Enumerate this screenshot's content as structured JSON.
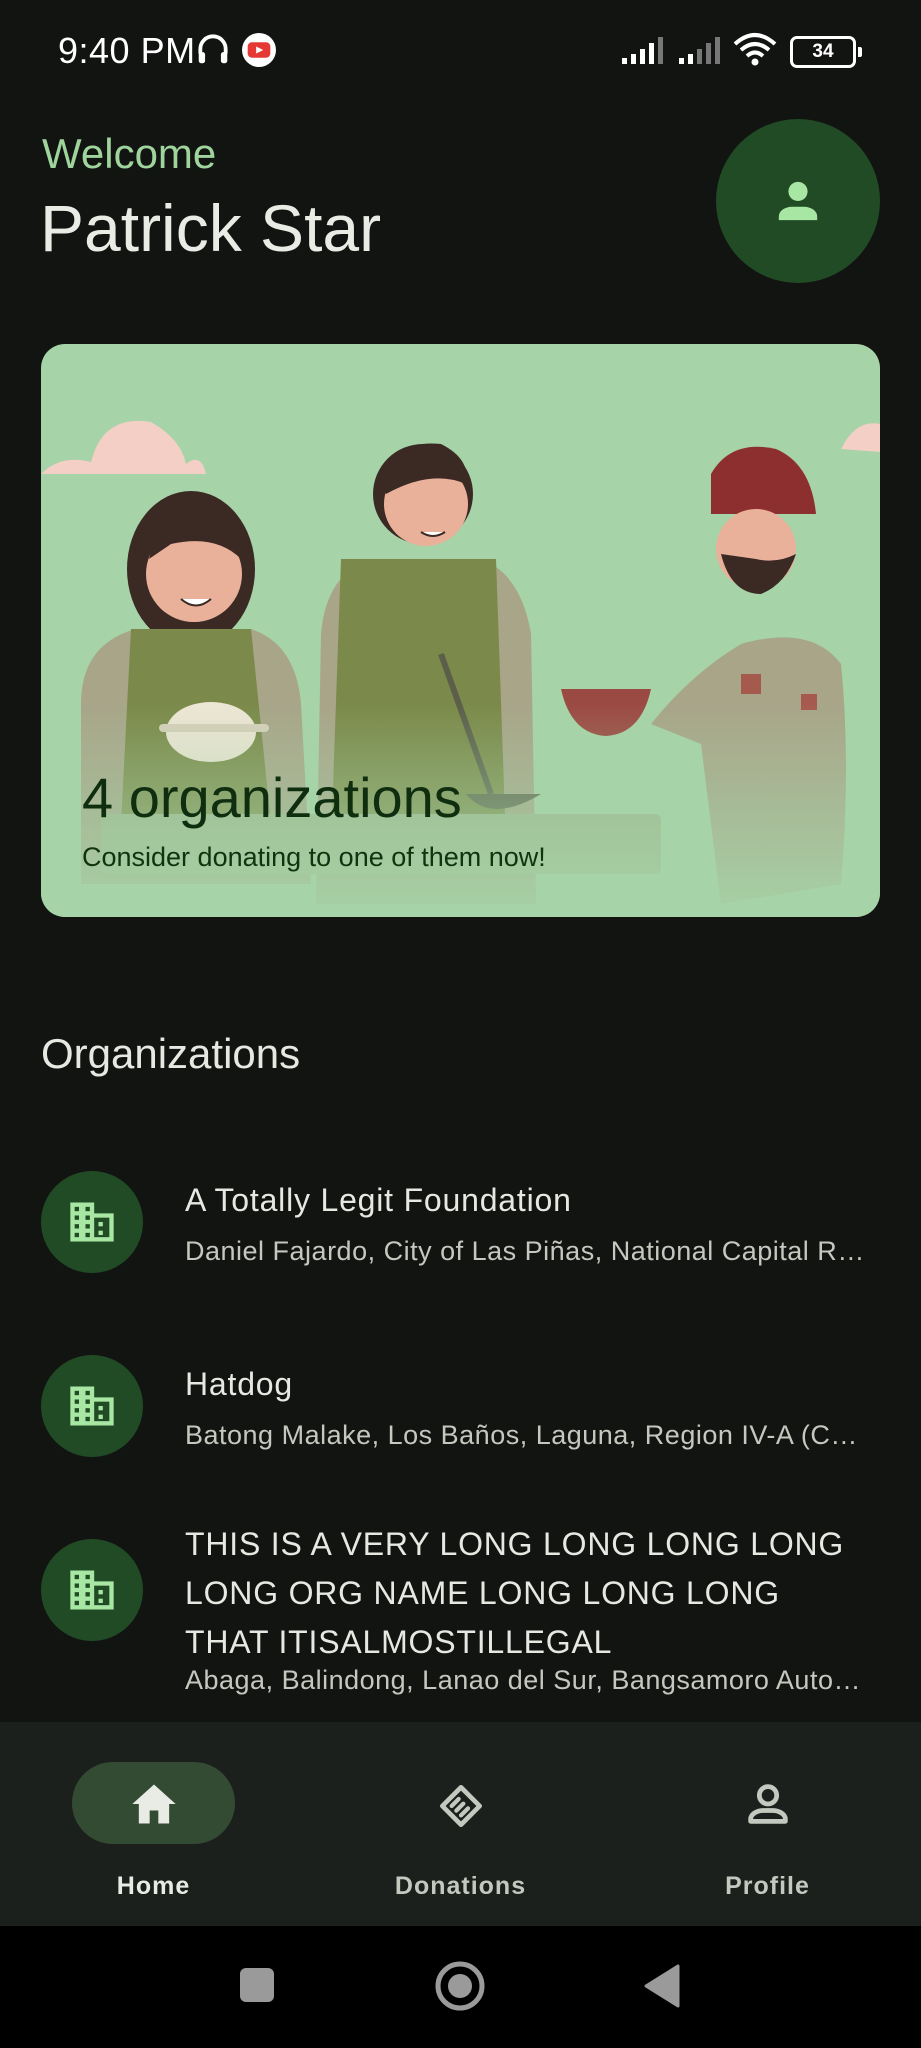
{
  "status_bar": {
    "time": "9:40 PM",
    "battery": "34",
    "icons": [
      "headphones-icon",
      "youtube-icon",
      "signal-icon",
      "signal-icon",
      "wifi-icon",
      "battery-icon"
    ]
  },
  "header": {
    "welcome": "Welcome",
    "user_name": "Patrick Star",
    "avatar_icon": "person-icon"
  },
  "banner": {
    "count_text": "4 organizations",
    "subtitle": "Consider donating to one of them now!"
  },
  "organizations": {
    "title": "Organizations",
    "items": [
      {
        "name": "A Totally Legit Foundation",
        "address": "Daniel Fajardo, City of Las Piñas, National Capital Region (NCR)",
        "icon": "building-icon"
      },
      {
        "name": "Hatdog",
        "address": "Batong Malake, Los Baños, Laguna, Region IV-A (CALABARZON)",
        "icon": "building-icon"
      },
      {
        "name": "THIS IS A VERY LONG LONG LONG LONG LONG ORG NAME LONG LONG LONG THAT ITISALMOSTILLEGAL",
        "address": "Abaga, Balindong, Lanao del Sur, Bangsamoro Autonomous Region",
        "icon": "building-icon"
      }
    ]
  },
  "bottom_nav": {
    "items": [
      {
        "label": "Home",
        "icon": "home-icon",
        "active": true
      },
      {
        "label": "Donations",
        "icon": "handshake-icon",
        "active": false
      },
      {
        "label": "Profile",
        "icon": "person-outline-icon",
        "active": false
      }
    ]
  },
  "colors": {
    "background": "#121412",
    "accent": "#9fd49c",
    "icon_container": "#214b24",
    "banner": "#a6d3a7"
  }
}
